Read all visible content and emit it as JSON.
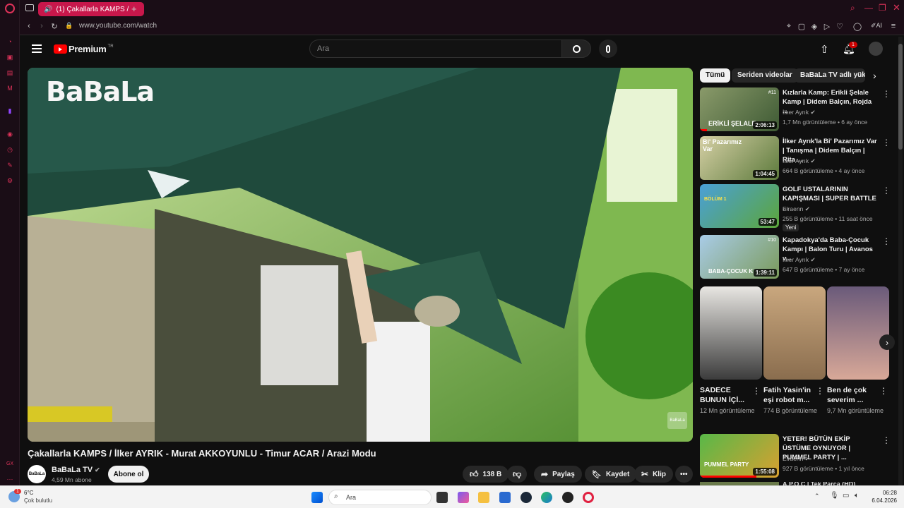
{
  "browser": {
    "tab_title": "(1) Çakallarla KAMPS /",
    "url": "www.youtube.com/watch"
  },
  "youtube": {
    "logo_text": "Premium",
    "logo_sup": "TR",
    "search_placeholder": "Ara",
    "notification_count": "1"
  },
  "video": {
    "overlay_logo": "BaBaLa",
    "watermark": "BaBaLa",
    "title": "Çakallarla KAMPS / İlker AYRIK - Murat AKKOYUNLU - Timur ACAR / Arazi Modu",
    "channel_name": "BaBaLa TV",
    "channel_subs": "4,59 Mn abone",
    "subscribe_label": "Abone ol",
    "likes": "138 B",
    "share_label": "Paylaş",
    "save_label": "Kaydet",
    "clip_label": "Klip"
  },
  "chips": [
    "Tümü",
    "Seriden videolar",
    "BaBaLa TV adlı yükle"
  ],
  "recommendations": [
    {
      "title": "Kızlarla Kamp: Erikli Şelale Kamp | Didem Balçın, Rojda ...",
      "channel": "İlker Ayrık",
      "meta": "1,7 Mn görüntüleme • 6 ay önce",
      "duration": "2:06:13",
      "thumb_text": "ERİKLİ ŞELALE",
      "badge": "#11"
    },
    {
      "title": "İlker Ayrık'la Bi' Pazarımız Var | Tanışma | Didem Balçın | Rita ...",
      "channel": "İlker Ayrık",
      "meta": "664 B görüntüleme • 4 ay önce",
      "duration": "1:04:45",
      "thumb_text": "Bi' Pazarımız Var",
      "badge": ""
    },
    {
      "title": "GOLF USTALARININ KAPIŞMASI | SUPER BATTLE ...",
      "channel": "Elraenn",
      "meta": "255 B görüntüleme • 11 saat önce",
      "duration": "53:47",
      "thumb_text": "BÖLÜM 1",
      "badge": "",
      "new_label": "Yeni"
    },
    {
      "title": "Kapadokya'da Baba-Çocuk Kampı | Balon Turu | Avanos v...",
      "channel": "İlker Ayrık",
      "meta": "647 B görüntüleme • 7 ay önce",
      "duration": "1:39:11",
      "thumb_text": "BABA-ÇOCUK K",
      "badge": "#10"
    }
  ],
  "shorts": [
    {
      "title": "SADECE BUNUN İÇİ...",
      "views": "12 Mn görüntüleme"
    },
    {
      "title": "Fatih Yasin'in eşi robot m...",
      "views": "774 B görüntüleme"
    },
    {
      "title": "Ben de çok severim ...",
      "views": "9,7 Mn görüntüleme"
    }
  ],
  "rec_bottom": {
    "title": "YETER! BÜTÜN EKİP ÜSTÜME OYNUYOR | PUMMEL PARTY | ...",
    "channel": "Elraenn",
    "meta": "927 B görüntüleme • 1 yıl önce",
    "duration": "1:55:08",
    "thumb_text": "PUMMEL PARTY"
  },
  "rec_cut": {
    "title": "A.P.O.C | Tek Parça (HD)"
  },
  "taskbar": {
    "weather_temp": "6°C",
    "weather_desc": "Çok bulutlu",
    "weather_badge": "1",
    "search_label": "Ara",
    "time": "06:28",
    "date": "6.04.2026"
  }
}
